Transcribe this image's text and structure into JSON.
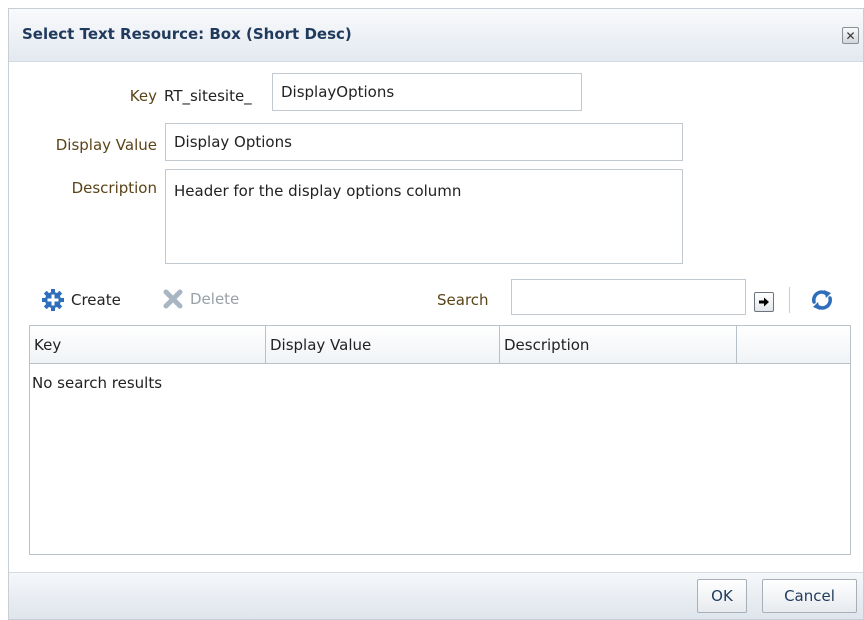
{
  "dialog": {
    "title": "Select Text Resource: Box (Short Desc)",
    "close_glyph": "✕"
  },
  "form": {
    "key_label": "Key",
    "key_prefix": "RT_sitesite_",
    "key_value": "DisplayOptions",
    "display_value_label": "Display Value",
    "display_value": "Display Options",
    "description_label": "Description",
    "description_value": "Header for the display options column"
  },
  "toolbar": {
    "create_label": "Create",
    "delete_label": "Delete",
    "search_label": "Search",
    "search_value": "",
    "icons": {
      "create": "gear-plus-icon",
      "delete": "x-icon",
      "go": "arrow-right-icon",
      "refresh": "refresh-icon"
    }
  },
  "table": {
    "columns": [
      "Key",
      "Display Value",
      "Description",
      ""
    ],
    "empty_text": "No search results"
  },
  "footer": {
    "ok_label": "OK",
    "cancel_label": "Cancel"
  },
  "colors": {
    "title": "#1f3a5c",
    "label": "#5a4418",
    "accent_blue": "#2f6eba"
  }
}
